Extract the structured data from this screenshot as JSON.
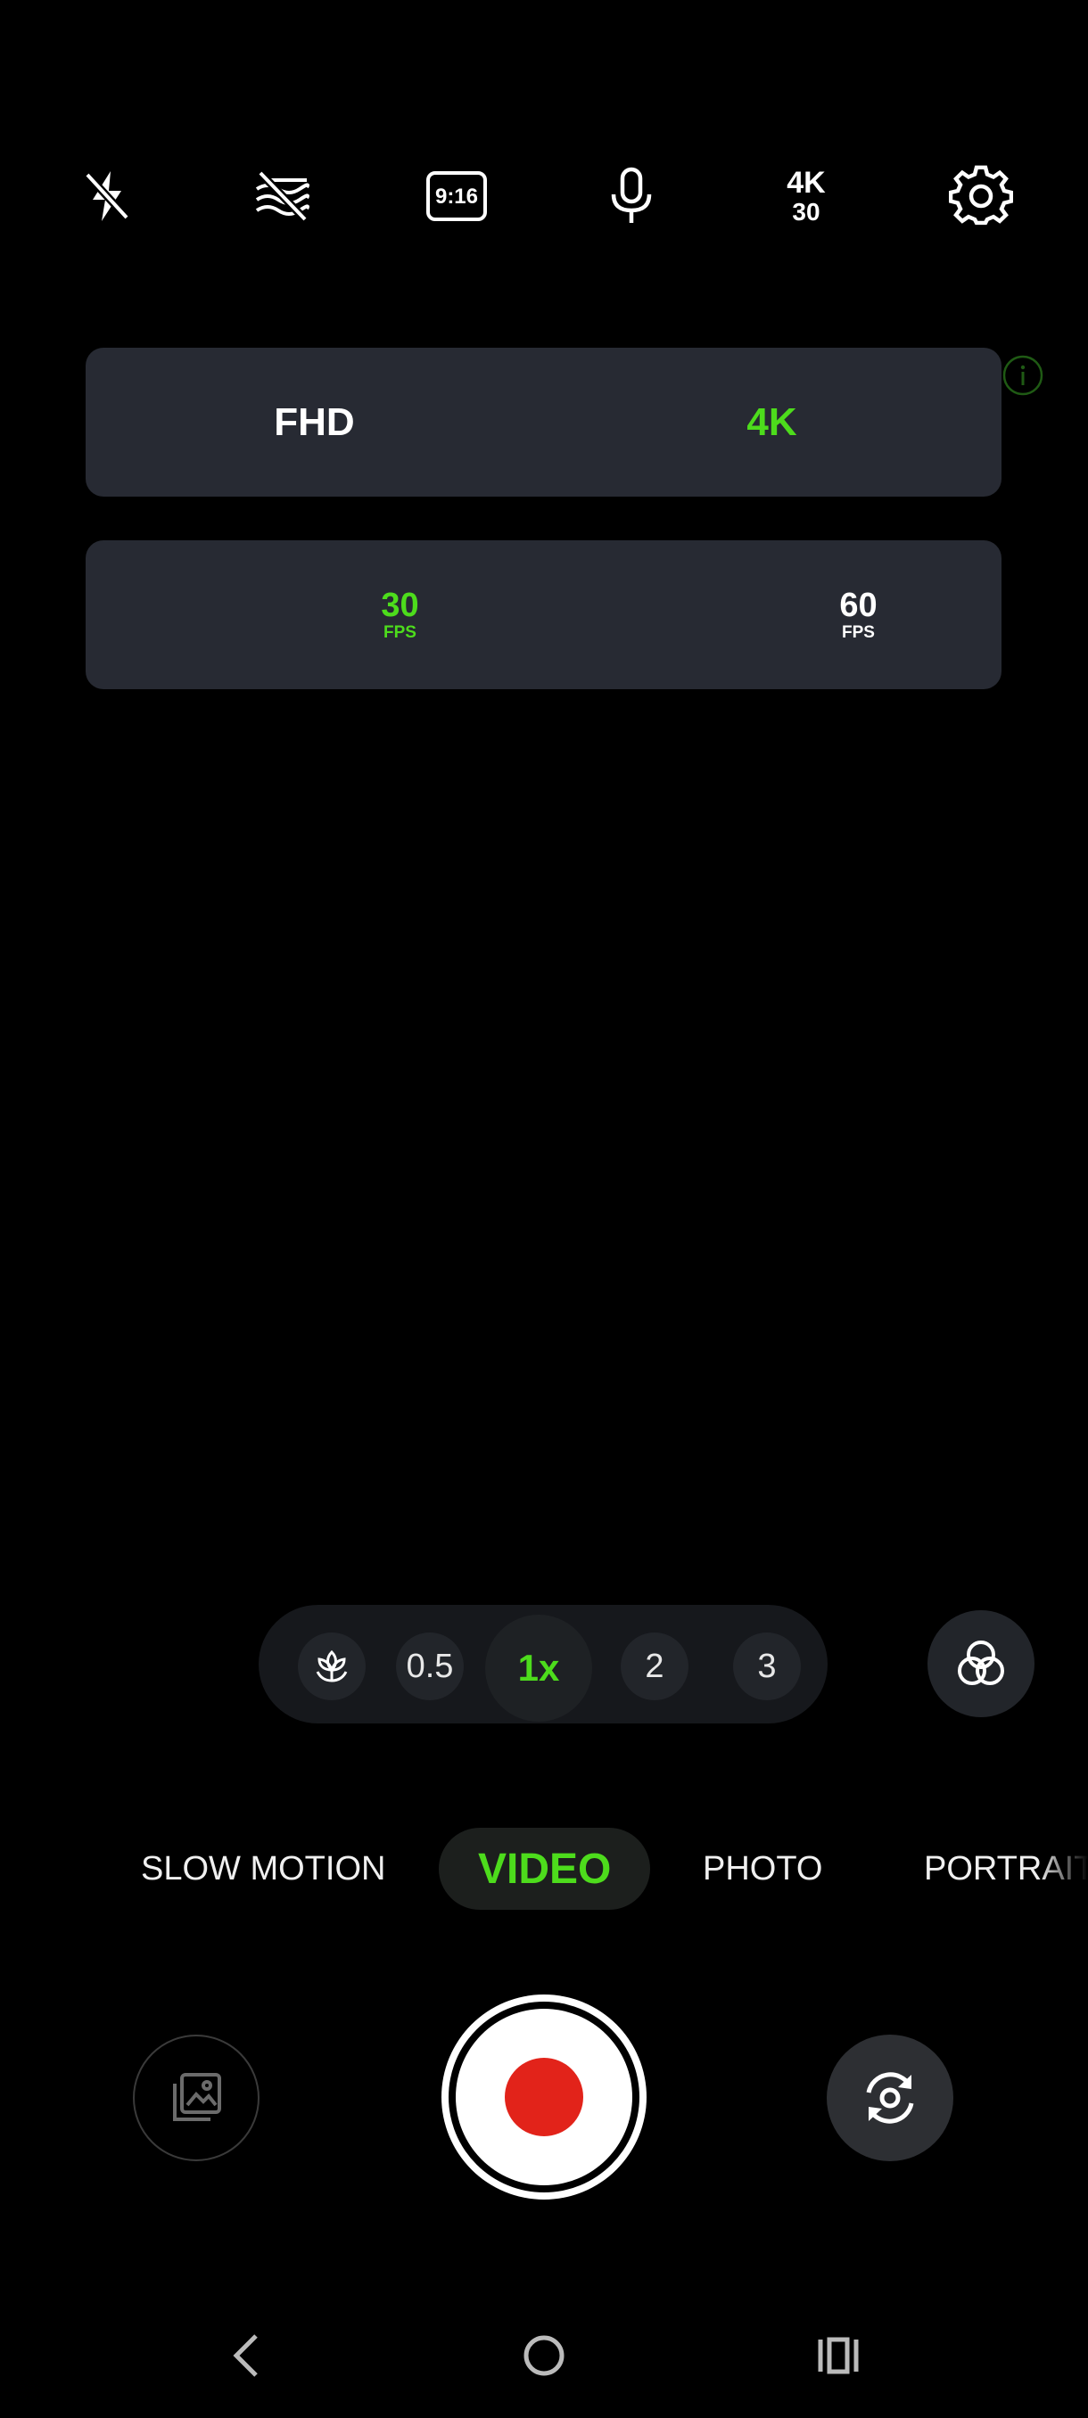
{
  "top_bar": {
    "icons": [
      "flash-off-icon",
      "hdr-off-icon",
      "aspect-ratio-icon",
      "microphone-icon",
      "resolution-badge",
      "settings-icon"
    ],
    "aspect_ratio": "9:16",
    "resolution_badge": {
      "res": "4K",
      "fps": "30"
    }
  },
  "resolution_panel": {
    "options": [
      "FHD",
      "4K"
    ],
    "selected": "4K"
  },
  "fps_panel": {
    "options": [
      {
        "value": "30",
        "unit": "FPS"
      },
      {
        "value": "60",
        "unit": "FPS"
      }
    ],
    "selected": "30"
  },
  "zoom": {
    "macro_icon": "flower-icon",
    "levels": [
      "0.5",
      "1x",
      "2",
      "3"
    ],
    "selected": "1x"
  },
  "filter_icon": "filters-icon",
  "modes": {
    "items": [
      "SLOW MOTION",
      "VIDEO",
      "PHOTO",
      "PORTRAIT"
    ],
    "selected": "VIDEO"
  },
  "controls": {
    "gallery_icon": "gallery-icon",
    "shutter": "record-button",
    "flip_icon": "flip-camera-icon"
  },
  "nav": [
    "back-icon",
    "home-icon",
    "recents-icon"
  ],
  "colors": {
    "accent": "#4ddc1c",
    "record": "#e2231a",
    "panel": "#272a33"
  }
}
